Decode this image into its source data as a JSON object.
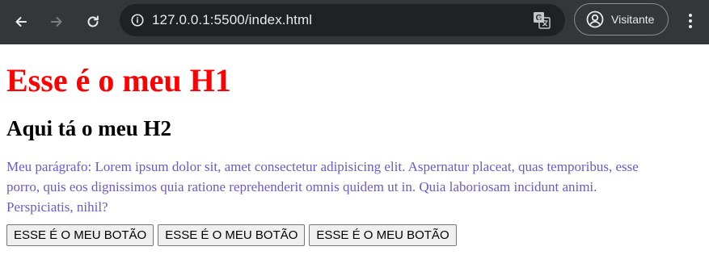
{
  "browser": {
    "url": "127.0.0.1:5500/index.html",
    "url_host": "127.0.0.1",
    "url_rest": ":5500/index.html",
    "profile_label": "Visitante",
    "icons": [
      "back-icon",
      "forward-icon",
      "reload-icon",
      "site-info-icon",
      "translate-icon",
      "profile-icon",
      "menu-icon"
    ]
  },
  "page": {
    "h1": "Esse é o meu H1",
    "h2": "Aqui tá o meu H2",
    "paragraph": "Meu parágrafo: Lorem ipsum dolor sit, amet consectetur adipisicing elit. Aspernatur placeat, quas temporibus, esse porro, quis eos dignissimos quia ratione reprehenderit omnis quidem ut in. Quia laboriosam incidunt animi. Perspiciatis, nihil?",
    "buttons": [
      "ESSE É O MEU BOTÃO",
      "ESSE É O MEU BOTÃO",
      "ESSE É O MEU BOTÃO"
    ]
  },
  "colors": {
    "h1": "#ff0000",
    "paragraph": "#6a5acd",
    "toolbar": "#35363a",
    "omnibox": "#202124"
  }
}
